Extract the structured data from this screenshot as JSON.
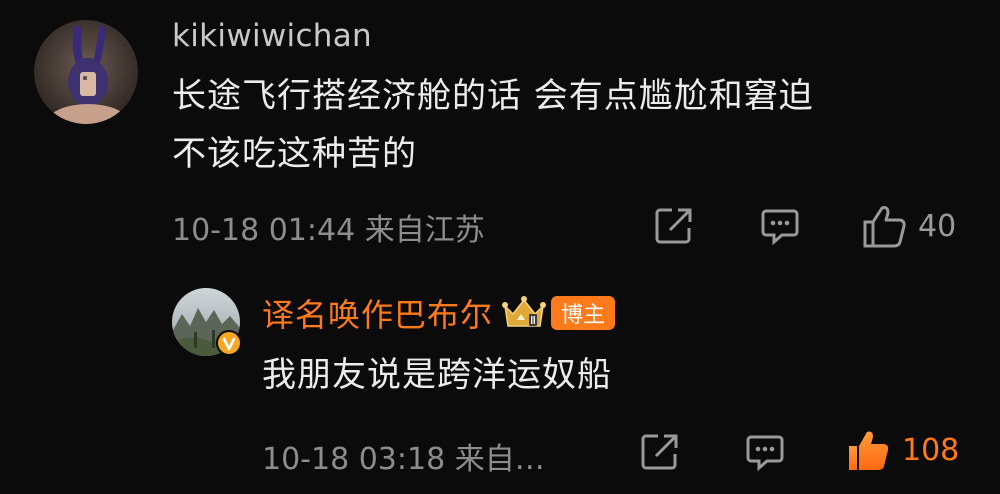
{
  "comments": [
    {
      "username": "kikiwiwichan",
      "text_line1": "长途飞行搭经济舱的话 会有点尴尬和窘迫",
      "text_line2": "不该吃这种苦的",
      "meta": "10-18 01:44  来自江苏",
      "like_count": "40",
      "liked": false
    },
    {
      "username": "译名唤作巴布尔",
      "badge": "博主",
      "text": "我朋友说是跨洋运奴船",
      "meta": "10-18 03:18  来自…",
      "like_count": "108",
      "liked": true
    }
  ],
  "colors": {
    "background": "#0b0b0b",
    "accent": "#ff7a1a",
    "meta_text": "#8d8d8d",
    "verified_badge": "#f5a623"
  },
  "icons": [
    "share-icon",
    "comment-icon",
    "like-icon",
    "crown-level-icon",
    "verified-v-icon"
  ]
}
